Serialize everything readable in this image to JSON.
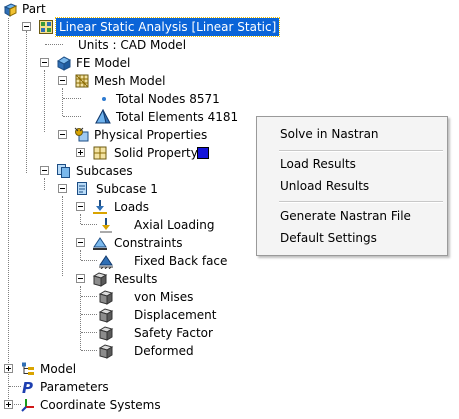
{
  "tree": {
    "part": "Part",
    "analysis": "Linear Static Analysis  [Linear Static]",
    "units": "Units : CAD Model",
    "fe_model": "FE Model",
    "mesh_model": "Mesh Model",
    "total_nodes": "Total Nodes 8571",
    "total_elements": "Total Elements 4181",
    "physical_properties": "Physical Properties",
    "solid_property": "Solid Property",
    "subcases": "Subcases",
    "subcase1": "Subcase 1",
    "loads": "Loads",
    "axial_loading": "Axial Loading",
    "constraints": "Constraints",
    "fixed_back_face": "Fixed Back face",
    "results": "Results",
    "von_mises": "von Mises",
    "displacement": "Displacement",
    "safety_factor": "Safety Factor",
    "deformed": "Deformed",
    "model": "Model",
    "parameters": "Parameters",
    "coordinate_systems": "Coordinate Systems"
  },
  "context_menu": {
    "solve": "Solve in Nastran",
    "load_results": "Load Results",
    "unload_results": "Unload Results",
    "generate_file": "Generate Nastran File",
    "default_settings": "Default Settings"
  },
  "colors": {
    "selection": "#0a64d8",
    "solid_property_swatch": "#1515d8"
  }
}
